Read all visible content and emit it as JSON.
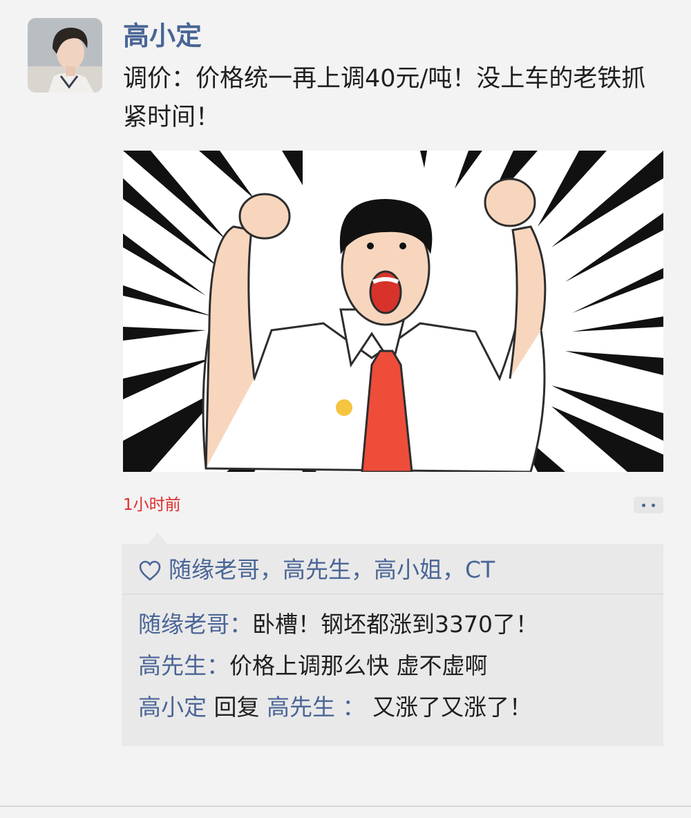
{
  "post": {
    "author": "高小定",
    "text": "调价：价格统一再上调40元/吨！没上车的老铁抓紧时间！",
    "timestamp": "1小时前"
  },
  "likes": {
    "names": "随缘老哥，高先生，高小姐，CT"
  },
  "comments": [
    {
      "author": "随缘老哥",
      "separator": "：",
      "text": "卧槽！钢坯都涨到3370了！"
    },
    {
      "author": "高先生",
      "separator": "：",
      "text": "价格上调那么快 虚不虚啊"
    },
    {
      "author": "高小定",
      "reply_word": " 回复 ",
      "reply_to": "高先生",
      "separator": " ： ",
      "text": "又涨了又涨了！"
    }
  ],
  "colors": {
    "link_blue": "#4a6596",
    "timestamp_red": "#e02b2b",
    "background": "#f3f3f3",
    "comment_box": "#e9e9e9"
  },
  "icons": {
    "like": "heart-outline-icon",
    "more": "more-dots-icon"
  }
}
